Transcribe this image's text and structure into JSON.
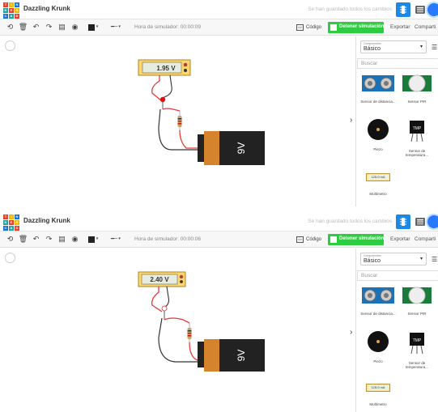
{
  "colors": {
    "accent_blue": "#1e88e5",
    "stop_green": "#2ecc40",
    "wire_red": "#e23b3b",
    "wire_black": "#333333",
    "battery_body": "#222222",
    "battery_cap": "#d5832c",
    "multimeter_body": "#ffd76e"
  },
  "screens": [
    {
      "app_title": "Dazzling Krunk",
      "save_status": "Se han guardado todos los cambios",
      "sim_time": "Hora de simulador: 00:00:09",
      "code_label": "Código",
      "stop_label": "Detener simulación",
      "export_label": "Exportar",
      "share_label": "Comparti",
      "components_small": "Componentes",
      "components_value": "Básico",
      "search_placeholder": "Buscar",
      "voltage": "1.95 V",
      "battery_label": "9V",
      "palette": {
        "distance": "Sensor de distancia...",
        "pir": "Sensor PIR",
        "piezo": "Piezo",
        "temp": "Sensor de temperatura...",
        "tmp_chip": "TMP",
        "multimeter": "Multímetro",
        "multimeter_value": "125.0 mA"
      }
    },
    {
      "app_title": "Dazzling Krunk",
      "save_status": "Se han guardado todos los cambios",
      "sim_time": "Hora de simulador: 00:00:06",
      "code_label": "Código",
      "stop_label": "Detener simulación",
      "export_label": "Exportar",
      "share_label": "Comparti",
      "components_small": "Componentes",
      "components_value": "Básico",
      "search_placeholder": "Buscar",
      "voltage": "2.40 V",
      "battery_label": "9V",
      "palette": {
        "distance": "Sensor de distancia...",
        "pir": "Sensor PIR",
        "piezo": "Piezo",
        "temp": "Sensor de temperatura...",
        "tmp_chip": "TMP",
        "multimeter": "Multímetro",
        "multimeter_value": "125.0 mA"
      }
    }
  ]
}
